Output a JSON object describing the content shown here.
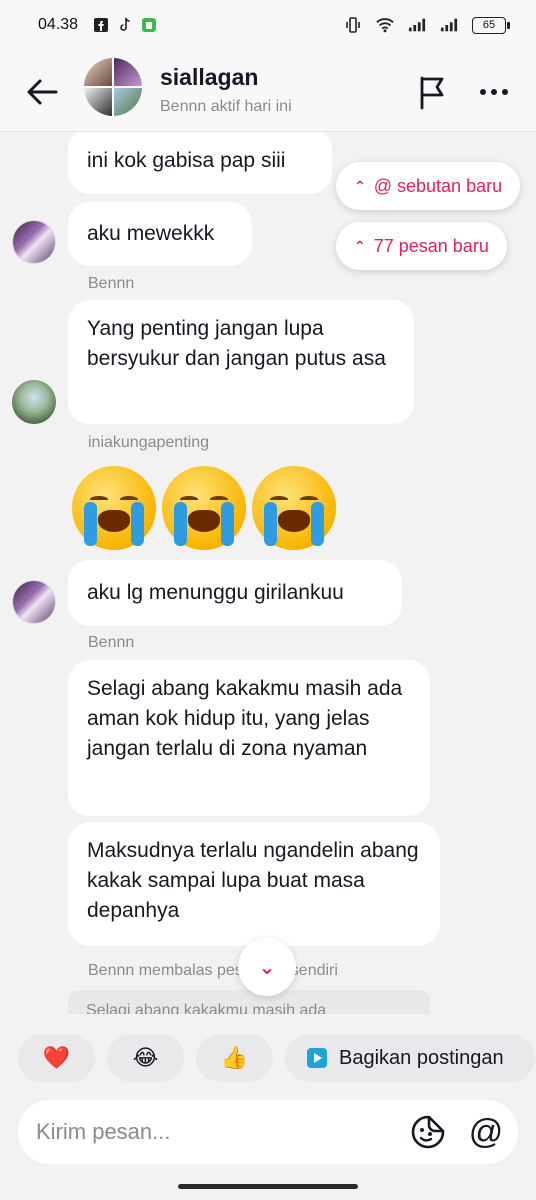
{
  "status_bar": {
    "time": "04.38",
    "battery": "65"
  },
  "header": {
    "title": "siallagan",
    "subtitle": "Bennn aktif hari ini"
  },
  "messages": [
    {
      "text": "ini kok gabisa pap siii"
    },
    {
      "text": "aku mewekkk"
    },
    {
      "sender": "Bennn",
      "text": "Yang penting jangan lupa bersyukur dan jangan putus asa"
    },
    {
      "sender": "iniakungapenting",
      "emoji": "😭😭😭"
    },
    {
      "text": "aku lg menunggu girilankuu"
    },
    {
      "sender": "Bennn",
      "text": "Selagi abang kakakmu masih ada aman kok hidup itu, yang jelas jangan terlalu di zona nyaman"
    },
    {
      "text": "Maksudnya terlalu ngandelin abang kakak sampai lupa buat masa depanhya"
    }
  ],
  "reply": {
    "label": "Bennn membalas pesannya sendiri",
    "quote": "Selagi abang kakakmu masih ada"
  },
  "notifications": {
    "mentions": "@ sebutan baru",
    "new_messages": "77 pesan baru"
  },
  "quick_replies": {
    "heart": "❤️",
    "laugh": "😂",
    "thumbs": "👍",
    "share": "Bagikan postingan"
  },
  "composer": {
    "placeholder": "Kirim pesan..."
  },
  "colors": {
    "accent": "#e0245e",
    "bubble": "#ffffff",
    "background": "#f2f2f2"
  }
}
